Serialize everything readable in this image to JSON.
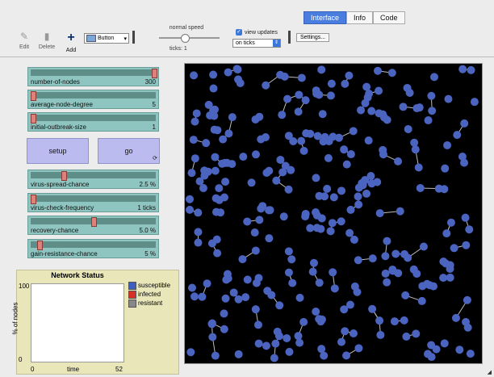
{
  "tabs": [
    "Interface",
    "Info",
    "Code"
  ],
  "toolbar": {
    "edit_label": "Edit",
    "delete_label": "Delete",
    "add_label": "Add",
    "widget_type": "Button",
    "speed_label": "normal speed",
    "ticks_label": "ticks: 1",
    "view_updates_label": "view updates",
    "update_mode": "on ticks",
    "settings_label": "Settings..."
  },
  "sliders": [
    {
      "name": "number-of-nodes",
      "value": "300",
      "fraction": 1.0
    },
    {
      "name": "average-node-degree",
      "value": "5",
      "fraction": 0.0
    },
    {
      "name": "initial-outbreak-size",
      "value": "1",
      "fraction": 0.0
    },
    {
      "name": "virus-spread-chance",
      "value": "2.5 %",
      "fraction": 0.25
    },
    {
      "name": "virus-check-frequency",
      "value": "1 ticks",
      "fraction": 0.0
    },
    {
      "name": "recovery-chance",
      "value": "5.0 %",
      "fraction": 0.5
    },
    {
      "name": "gain-resistance-chance",
      "value": "5 %",
      "fraction": 0.05
    }
  ],
  "buttons": {
    "setup": "setup",
    "go": "go"
  },
  "plot": {
    "title": "Network Status",
    "ylabel": "% of nodes",
    "xlabel": "time",
    "ymax": "100",
    "ymin": "0",
    "xmin": "0",
    "xmax": "52",
    "legend": [
      {
        "label": "susceptible",
        "color": "#3f5fbf"
      },
      {
        "label": "infected",
        "color": "#d73027"
      },
      {
        "label": "resistant",
        "color": "#888888"
      }
    ]
  },
  "world": {
    "background": "#000000",
    "node_color": "#4a64c0",
    "link_color": "#bbbbbb"
  }
}
